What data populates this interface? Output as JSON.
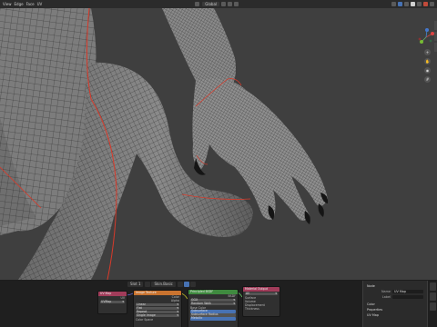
{
  "topbar": {
    "menus": [
      "View",
      "Edge",
      "Face",
      "UV"
    ],
    "center_label": "Global"
  },
  "viewport": {
    "gizmo": {
      "axes": [
        "X",
        "Y",
        "Z"
      ]
    },
    "nav_icons": [
      "zoom-icon",
      "hand-icon",
      "camera-icon",
      "grid-icon"
    ]
  },
  "node_editor": {
    "header": {
      "slot_label": "Slot 1",
      "material_label": "Skin.Basic"
    },
    "nodes": {
      "color_attr": {
        "title": "UV Map",
        "rows": [
          "UV"
        ],
        "field": "UVMap"
      },
      "texture": {
        "title": "Image Texture",
        "rows": [
          "Color",
          "Alpha"
        ],
        "fields": [
          "Linear",
          "Flat",
          "Repeat",
          "Single Image",
          "Color Space",
          "Alpha",
          "Vector"
        ]
      },
      "bsdf": {
        "title": "Principled BSDF",
        "rows": [
          "BSDF"
        ],
        "fields": [
          "GGX",
          "Random Walk",
          "Base Color",
          "Subsurface",
          "Subsurface Radius",
          "Subsurface Color",
          "Metallic",
          "Specular",
          "Roughness"
        ]
      },
      "output": {
        "title": "Material Output",
        "rows": [
          "All",
          "Surface",
          "Volume",
          "Displacement",
          "Thickness"
        ]
      }
    }
  },
  "properties": {
    "section": "Node",
    "name_label": "Name",
    "name_value": "UV Map",
    "label_label": "Label",
    "color_label": "Color",
    "props_label": "Properties",
    "uv_label": "UV Map"
  },
  "colors": {
    "accent": "#4772b3",
    "node_header_input": "#a13c5a",
    "node_header_texture": "#c9732f",
    "node_header_shader": "#3f8a3f",
    "node_header_output": "#a13c5a",
    "seam": "#d83a2a"
  }
}
